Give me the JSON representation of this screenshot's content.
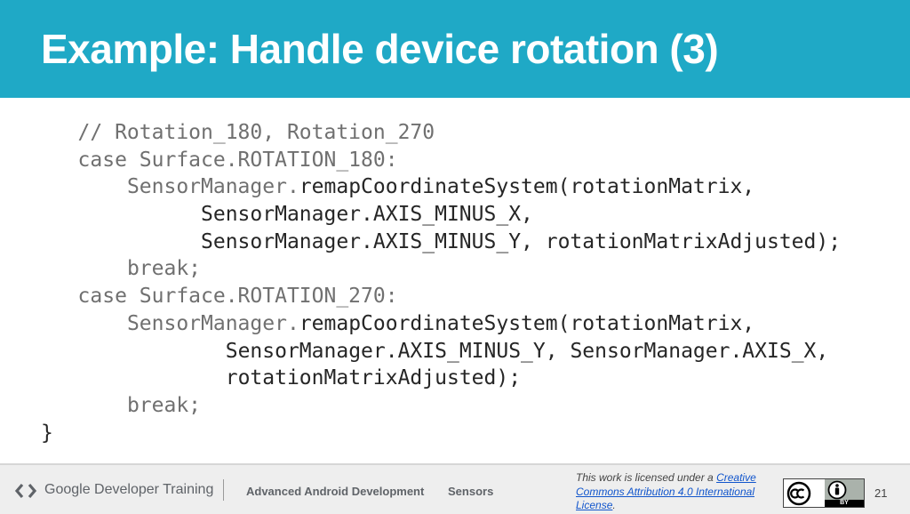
{
  "slide": {
    "title": "Example: Handle device rotation (3)",
    "code_lines": [
      {
        "indent": "   ",
        "segments": [
          {
            "text": "// Rotation_180, Rotation_270",
            "style": "gray"
          }
        ]
      },
      {
        "indent": "   ",
        "segments": [
          {
            "text": "case Surface.ROTATION_180:",
            "style": "gray"
          }
        ]
      },
      {
        "indent": "       ",
        "segments": [
          {
            "text": "SensorManager.",
            "style": "gray"
          },
          {
            "text": "remapCoordinateSystem(rotationMatrix,",
            "style": "dark"
          }
        ]
      },
      {
        "indent": "             ",
        "segments": [
          {
            "text": "SensorManager.AXIS_MINUS_X,",
            "style": "dark"
          }
        ]
      },
      {
        "indent": "             ",
        "segments": [
          {
            "text": "SensorManager.AXIS_MINUS_Y, rotationMatrixAdjusted);",
            "style": "dark"
          }
        ]
      },
      {
        "indent": "       ",
        "segments": [
          {
            "text": "break;",
            "style": "gray"
          }
        ]
      },
      {
        "indent": "   ",
        "segments": [
          {
            "text": "case Surface.ROTATION_270:",
            "style": "gray"
          }
        ]
      },
      {
        "indent": "       ",
        "segments": [
          {
            "text": "SensorManager.",
            "style": "gray"
          },
          {
            "text": "remapCoordinateSystem(rotationMatrix,",
            "style": "dark"
          }
        ]
      },
      {
        "indent": "               ",
        "segments": [
          {
            "text": "SensorManager.AXIS_MINUS_Y, SensorManager.AXIS_X,",
            "style": "dark"
          }
        ]
      },
      {
        "indent": "               ",
        "segments": [
          {
            "text": "rotationMatrixAdjusted);",
            "style": "dark"
          }
        ]
      },
      {
        "indent": "       ",
        "segments": [
          {
            "text": "break;",
            "style": "gray"
          }
        ]
      },
      {
        "indent": "",
        "segments": [
          {
            "text": "}",
            "style": "dark"
          }
        ]
      }
    ]
  },
  "footer": {
    "brand": "Google Developer Training",
    "brand_icon": "google-developers-logo-icon",
    "course": "Advanced Android Development",
    "topic": "Sensors",
    "license_prefix": "This work is licensed under a ",
    "license_link": "Creative Commons Attribution 4.0 International License",
    "license_suffix": ".",
    "cc_icon": "cc-by-badge-icon",
    "page_number": "21"
  },
  "colors": {
    "header_bg": "#1fa9c6",
    "footer_bg": "#eeeeee",
    "link": "#1155cc"
  }
}
